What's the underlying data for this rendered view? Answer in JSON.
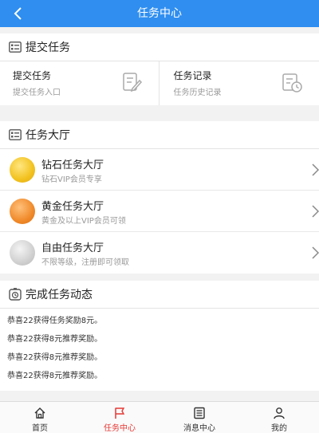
{
  "header": {
    "title": "任务中心"
  },
  "submit_section": {
    "title": "提交任务",
    "cells": [
      {
        "title": "提交任务",
        "subtitle": "提交任务入口",
        "icon": "edit-form-icon"
      },
      {
        "title": "任务记录",
        "subtitle": "任务历史记录",
        "icon": "record-clock-icon"
      }
    ]
  },
  "hall_section": {
    "title": "任务大厅",
    "items": [
      {
        "title": "钻石任务大厅",
        "subtitle": "钻石VIP会员专享",
        "coin": "gold"
      },
      {
        "title": "黄金任务大厅",
        "subtitle": "黄金及以上VIP会员可领",
        "coin": "bronze"
      },
      {
        "title": "自由任务大厅",
        "subtitle": "不限等级，注册即可领取",
        "coin": "silver"
      }
    ]
  },
  "news_section": {
    "title": "完成任务动态",
    "lines": [
      "恭喜22获得任务奖励8元。",
      "恭喜22获得8元推荐奖励。",
      "恭喜22获得8元推荐奖励。",
      "恭喜22获得8元推荐奖励。"
    ]
  },
  "tabbar": {
    "active": "任务中心",
    "tabs": [
      {
        "label": "首页",
        "icon": "home-icon"
      },
      {
        "label": "任务中心",
        "icon": "flag-icon"
      },
      {
        "label": "消息中心",
        "icon": "message-list-icon"
      },
      {
        "label": "我的",
        "icon": "user-icon"
      }
    ]
  },
  "colors": {
    "header_bg": "#2f8ef0",
    "active_tab": "#e53935",
    "page_bg": "#f2f2f2"
  }
}
